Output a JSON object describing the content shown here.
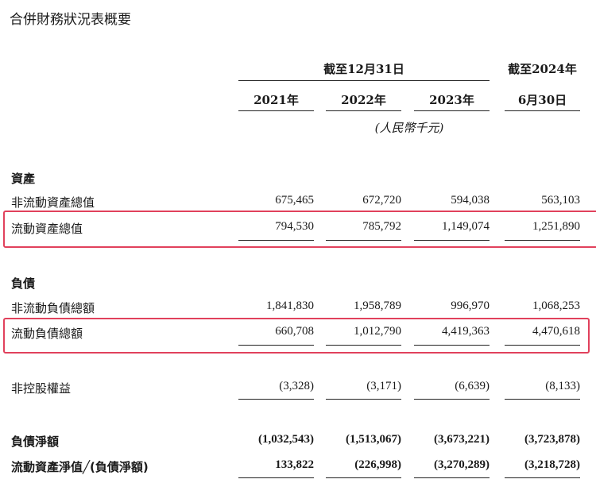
{
  "title": "合併財務狀況表概要",
  "header": {
    "group1": "截至12月31日",
    "group2": "截至2024年",
    "columns": [
      "2021年",
      "2022年",
      "2023年",
      "6月30日"
    ],
    "unit": "(人民幣千元)"
  },
  "sections": {
    "assets": "資產",
    "liabilities": "負債"
  },
  "rows": {
    "non_current_assets": {
      "label": "非流動資產總值",
      "values": [
        "675,465",
        "672,720",
        "594,038",
        "563,103"
      ]
    },
    "current_assets": {
      "label": "流動資產總值",
      "values": [
        "794,530",
        "785,792",
        "1,149,074",
        "1,251,890"
      ]
    },
    "non_current_liabilities": {
      "label": "非流動負債總額",
      "values": [
        "1,841,830",
        "1,958,789",
        "996,970",
        "1,068,253"
      ]
    },
    "current_liabilities": {
      "label": "流動負債總額",
      "values": [
        "660,708",
        "1,012,790",
        "4,419,363",
        "4,470,618"
      ]
    },
    "nci": {
      "label": "非控股權益",
      "values": [
        "(3,328)",
        "(3,171)",
        "(6,639)",
        "(8,133)"
      ]
    },
    "net_liabilities": {
      "label": "負債淨額",
      "values": [
        "(1,032,543)",
        "(1,513,067)",
        "(3,673,221)",
        "(3,723,878)"
      ]
    },
    "net_current": {
      "label": "流動資產淨值╱(負債淨額)",
      "values": [
        "133,822",
        "(226,998)",
        "(3,270,289)",
        "(3,218,728)"
      ]
    }
  },
  "highlight_color": "#e1415c"
}
